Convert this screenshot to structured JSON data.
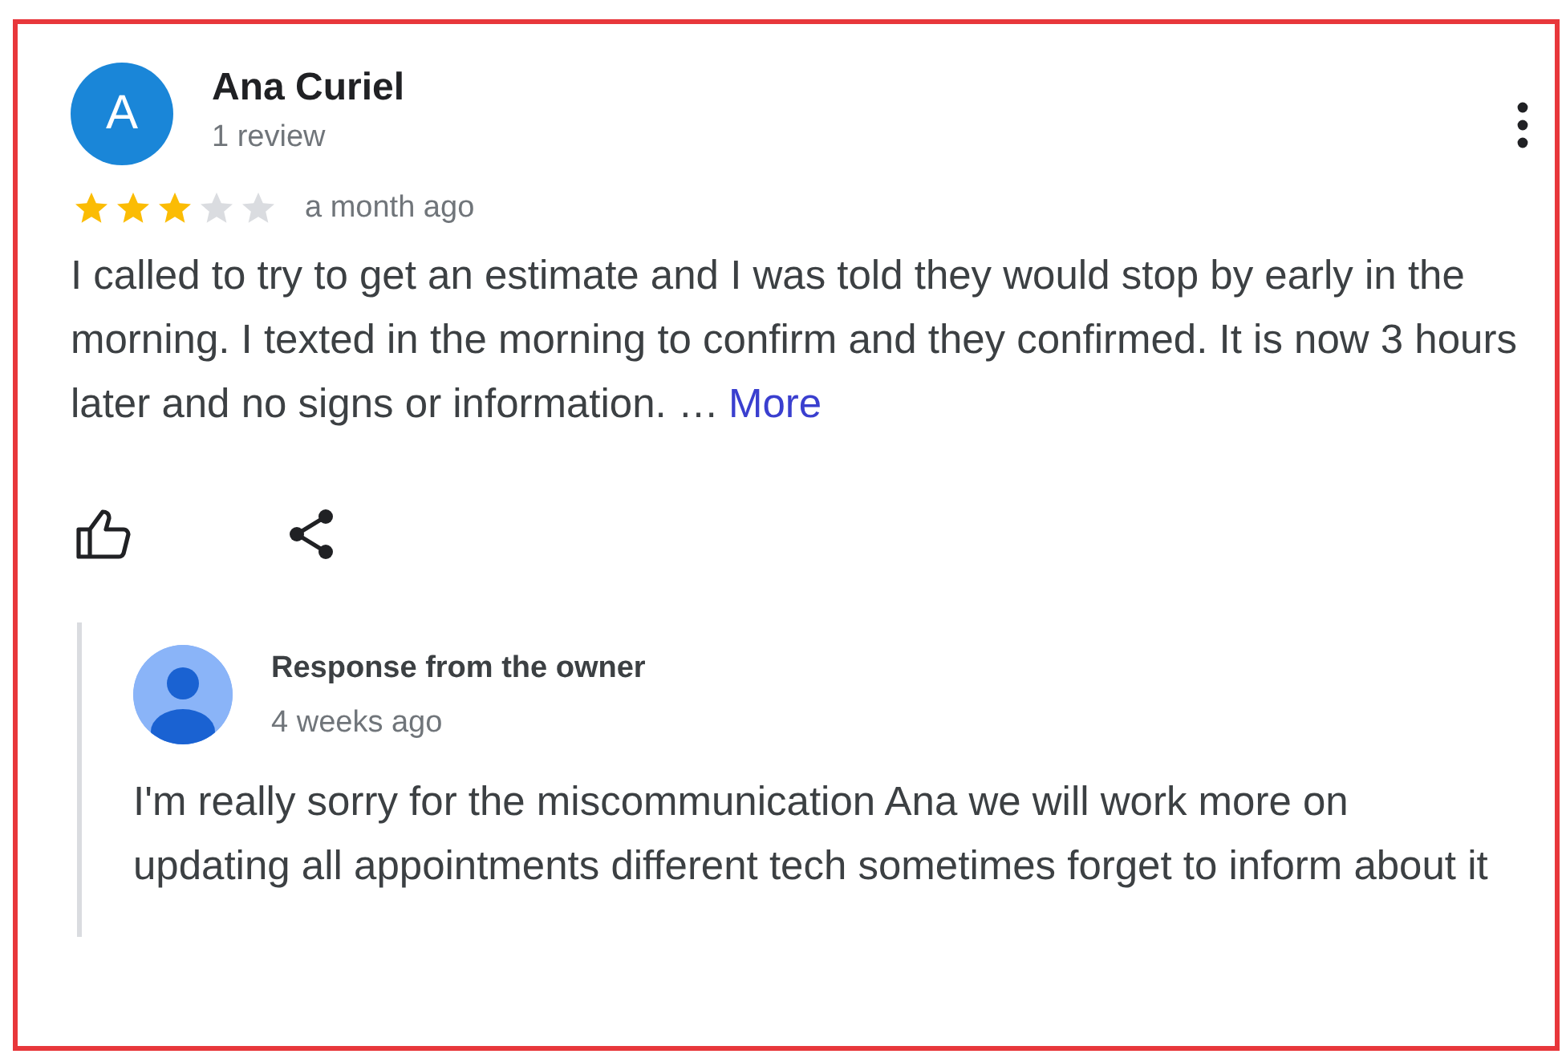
{
  "review": {
    "author": "Ana Curiel",
    "avatar_letter": "A",
    "review_count": "1 review",
    "stars": 3,
    "time": "a month ago",
    "text": "I called to try to get an estimate and I was told they would stop by early in the morning. I texted in the morning to confirm and they confirmed. It is now 3 hours later and no signs or information. …",
    "more": "More"
  },
  "owner_response": {
    "title": "Response from the owner",
    "time": "4 weeks ago",
    "text": "I'm really sorry for the miscommunication Ana we will work more on updating all appointments different tech sometimes forget to inform about it"
  }
}
